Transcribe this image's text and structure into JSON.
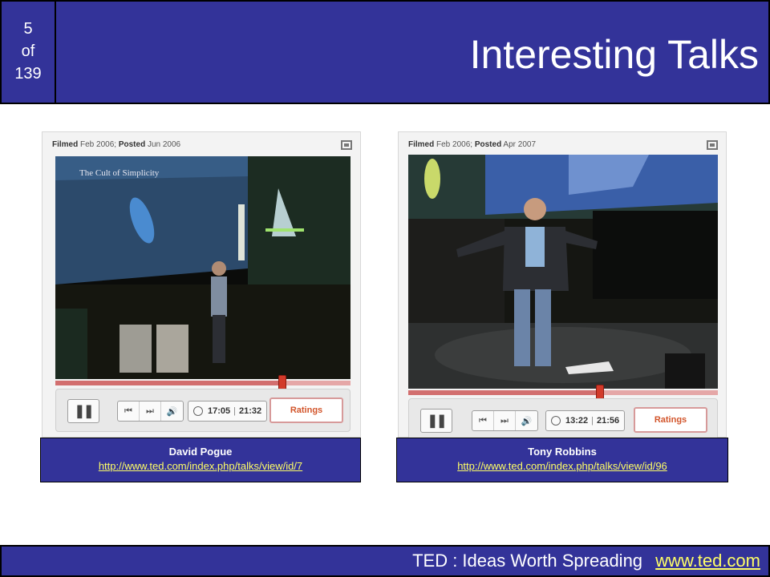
{
  "slide": {
    "counter": {
      "current": "5",
      "of": "of",
      "total": "139"
    },
    "title": "Interesting Talks"
  },
  "talks": [
    {
      "meta": {
        "filmed_label": "Filmed",
        "filmed": "Feb 2006;",
        "posted_label": "Posted",
        "posted": "Jun 2006"
      },
      "screen_text": "The Cult of Simplicity",
      "progress": 0.77,
      "time_current": "17:05",
      "time_total": "21:32",
      "ratings_label": "Ratings",
      "speaker": "David Pogue",
      "url": "http://www.ted.com/index.php/talks/view/id/7"
    },
    {
      "meta": {
        "filmed_label": "Filmed",
        "filmed": "Feb 2006;",
        "posted_label": "Posted",
        "posted": "Apr 2007"
      },
      "progress": 0.62,
      "time_current": "13:22",
      "time_total": "21:56",
      "ratings_label": "Ratings",
      "speaker": "Tony Robbins",
      "url": "http://www.ted.com/index.php/talks/view/id/96"
    }
  ],
  "footer": {
    "text": "TED : Ideas Worth Spreading",
    "link": "www.ted.com"
  },
  "colors": {
    "header_bg": "#333399",
    "link": "#ffff66",
    "scrub_knob": "#d23a2a"
  },
  "icons": [
    "pause-icon",
    "previous-icon",
    "next-icon",
    "volume-icon",
    "clock-icon",
    "fullscreen-icon"
  ]
}
